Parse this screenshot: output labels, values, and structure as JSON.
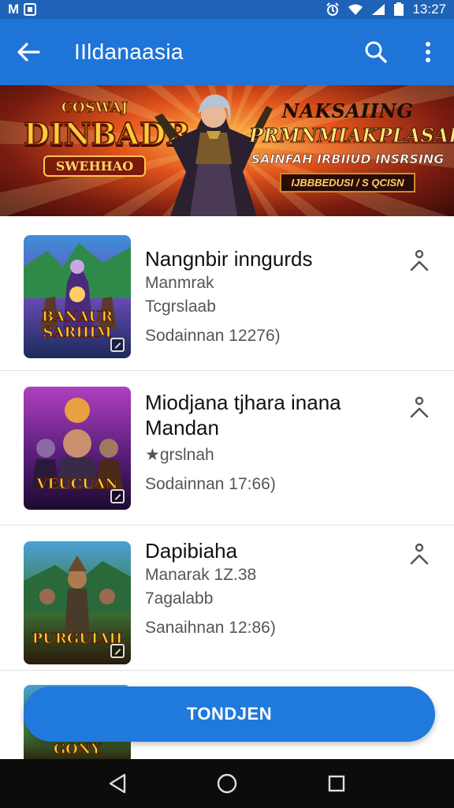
{
  "status_bar": {
    "left_text": "M",
    "time": "13:27"
  },
  "app_bar": {
    "title": "IIldanaasia",
    "back_icon": "arrow-left-icon",
    "search_icon": "search-icon",
    "menu_icon": "more-vert-icon"
  },
  "banner": {
    "logo_top": "COSWAJ",
    "logo_main": "DINBADRA",
    "logo_sub": "SWEHHAO",
    "line1": "NAKSAIING",
    "line2": "PRMNMIAKPLASAI!",
    "line3": "SAINFAH IRBIIUD INSRSING",
    "line4": "IJBBBEDUSI / S QCISN"
  },
  "items": [
    {
      "title": "Nangnbir inngurds",
      "line1": "Manmrak",
      "line2": "Tcgrslaab",
      "date": "Sodainnan 12276)",
      "thumb_text": "BANAUR SARHIM",
      "thumb_colors": [
        "#3d8fd8",
        "#6a4bb5",
        "#1c2a5a"
      ],
      "action_icon": "person-caret-icon"
    },
    {
      "title": "Miodjana tjhara  inana",
      "line1": "Mandan",
      "line2": "★grslnah",
      "date": "Sodainnan 17:66)",
      "thumb_text": "VEUCUAN",
      "thumb_colors": [
        "#b040c0",
        "#5a1e7a",
        "#1d0a30"
      ],
      "action_icon": "person-caret-icon"
    },
    {
      "title": "Dapibiaha",
      "line1": "Manarak 1Z.38",
      "line2": "7agalabb",
      "date": "Sanaihnan 12:86)",
      "thumb_text": "PURGUIAH",
      "thumb_colors": [
        "#4aa0d8",
        "#3f7a3a",
        "#2a1a0a"
      ],
      "action_icon": "person-caret-icon"
    }
  ],
  "peek_item": {
    "thumb_text": "GONY"
  },
  "cta": {
    "label": "TONDJEN"
  },
  "nav": {
    "back_icon": "nav-back-icon",
    "home_icon": "nav-home-icon",
    "recents_icon": "nav-recents-icon"
  }
}
